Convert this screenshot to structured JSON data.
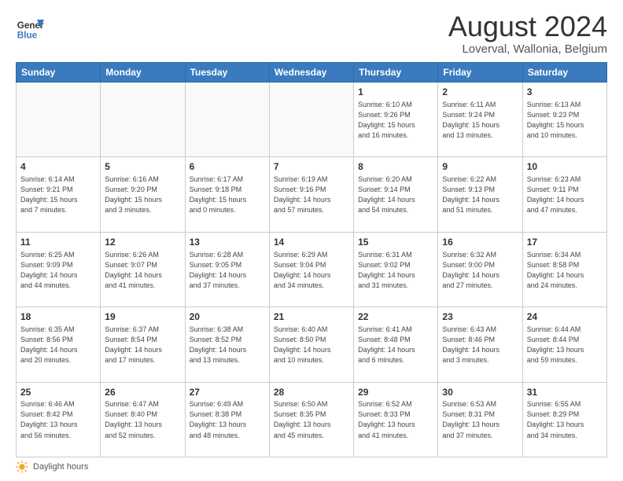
{
  "header": {
    "logo_line1": "General",
    "logo_line2": "Blue",
    "month": "August 2024",
    "location": "Loverval, Wallonia, Belgium"
  },
  "days_of_week": [
    "Sunday",
    "Monday",
    "Tuesday",
    "Wednesday",
    "Thursday",
    "Friday",
    "Saturday"
  ],
  "weeks": [
    [
      {
        "day": "",
        "info": ""
      },
      {
        "day": "",
        "info": ""
      },
      {
        "day": "",
        "info": ""
      },
      {
        "day": "",
        "info": ""
      },
      {
        "day": "1",
        "info": "Sunrise: 6:10 AM\nSunset: 9:26 PM\nDaylight: 15 hours\nand 16 minutes."
      },
      {
        "day": "2",
        "info": "Sunrise: 6:11 AM\nSunset: 9:24 PM\nDaylight: 15 hours\nand 13 minutes."
      },
      {
        "day": "3",
        "info": "Sunrise: 6:13 AM\nSunset: 9:23 PM\nDaylight: 15 hours\nand 10 minutes."
      }
    ],
    [
      {
        "day": "4",
        "info": "Sunrise: 6:14 AM\nSunset: 9:21 PM\nDaylight: 15 hours\nand 7 minutes."
      },
      {
        "day": "5",
        "info": "Sunrise: 6:16 AM\nSunset: 9:20 PM\nDaylight: 15 hours\nand 3 minutes."
      },
      {
        "day": "6",
        "info": "Sunrise: 6:17 AM\nSunset: 9:18 PM\nDaylight: 15 hours\nand 0 minutes."
      },
      {
        "day": "7",
        "info": "Sunrise: 6:19 AM\nSunset: 9:16 PM\nDaylight: 14 hours\nand 57 minutes."
      },
      {
        "day": "8",
        "info": "Sunrise: 6:20 AM\nSunset: 9:14 PM\nDaylight: 14 hours\nand 54 minutes."
      },
      {
        "day": "9",
        "info": "Sunrise: 6:22 AM\nSunset: 9:13 PM\nDaylight: 14 hours\nand 51 minutes."
      },
      {
        "day": "10",
        "info": "Sunrise: 6:23 AM\nSunset: 9:11 PM\nDaylight: 14 hours\nand 47 minutes."
      }
    ],
    [
      {
        "day": "11",
        "info": "Sunrise: 6:25 AM\nSunset: 9:09 PM\nDaylight: 14 hours\nand 44 minutes."
      },
      {
        "day": "12",
        "info": "Sunrise: 6:26 AM\nSunset: 9:07 PM\nDaylight: 14 hours\nand 41 minutes."
      },
      {
        "day": "13",
        "info": "Sunrise: 6:28 AM\nSunset: 9:05 PM\nDaylight: 14 hours\nand 37 minutes."
      },
      {
        "day": "14",
        "info": "Sunrise: 6:29 AM\nSunset: 9:04 PM\nDaylight: 14 hours\nand 34 minutes."
      },
      {
        "day": "15",
        "info": "Sunrise: 6:31 AM\nSunset: 9:02 PM\nDaylight: 14 hours\nand 31 minutes."
      },
      {
        "day": "16",
        "info": "Sunrise: 6:32 AM\nSunset: 9:00 PM\nDaylight: 14 hours\nand 27 minutes."
      },
      {
        "day": "17",
        "info": "Sunrise: 6:34 AM\nSunset: 8:58 PM\nDaylight: 14 hours\nand 24 minutes."
      }
    ],
    [
      {
        "day": "18",
        "info": "Sunrise: 6:35 AM\nSunset: 8:56 PM\nDaylight: 14 hours\nand 20 minutes."
      },
      {
        "day": "19",
        "info": "Sunrise: 6:37 AM\nSunset: 8:54 PM\nDaylight: 14 hours\nand 17 minutes."
      },
      {
        "day": "20",
        "info": "Sunrise: 6:38 AM\nSunset: 8:52 PM\nDaylight: 14 hours\nand 13 minutes."
      },
      {
        "day": "21",
        "info": "Sunrise: 6:40 AM\nSunset: 8:50 PM\nDaylight: 14 hours\nand 10 minutes."
      },
      {
        "day": "22",
        "info": "Sunrise: 6:41 AM\nSunset: 8:48 PM\nDaylight: 14 hours\nand 6 minutes."
      },
      {
        "day": "23",
        "info": "Sunrise: 6:43 AM\nSunset: 8:46 PM\nDaylight: 14 hours\nand 3 minutes."
      },
      {
        "day": "24",
        "info": "Sunrise: 6:44 AM\nSunset: 8:44 PM\nDaylight: 13 hours\nand 59 minutes."
      }
    ],
    [
      {
        "day": "25",
        "info": "Sunrise: 6:46 AM\nSunset: 8:42 PM\nDaylight: 13 hours\nand 56 minutes."
      },
      {
        "day": "26",
        "info": "Sunrise: 6:47 AM\nSunset: 8:40 PM\nDaylight: 13 hours\nand 52 minutes."
      },
      {
        "day": "27",
        "info": "Sunrise: 6:49 AM\nSunset: 8:38 PM\nDaylight: 13 hours\nand 48 minutes."
      },
      {
        "day": "28",
        "info": "Sunrise: 6:50 AM\nSunset: 8:35 PM\nDaylight: 13 hours\nand 45 minutes."
      },
      {
        "day": "29",
        "info": "Sunrise: 6:52 AM\nSunset: 8:33 PM\nDaylight: 13 hours\nand 41 minutes."
      },
      {
        "day": "30",
        "info": "Sunrise: 6:53 AM\nSunset: 8:31 PM\nDaylight: 13 hours\nand 37 minutes."
      },
      {
        "day": "31",
        "info": "Sunrise: 6:55 AM\nSunset: 8:29 PM\nDaylight: 13 hours\nand 34 minutes."
      }
    ]
  ],
  "footer": {
    "label": "Daylight hours"
  }
}
